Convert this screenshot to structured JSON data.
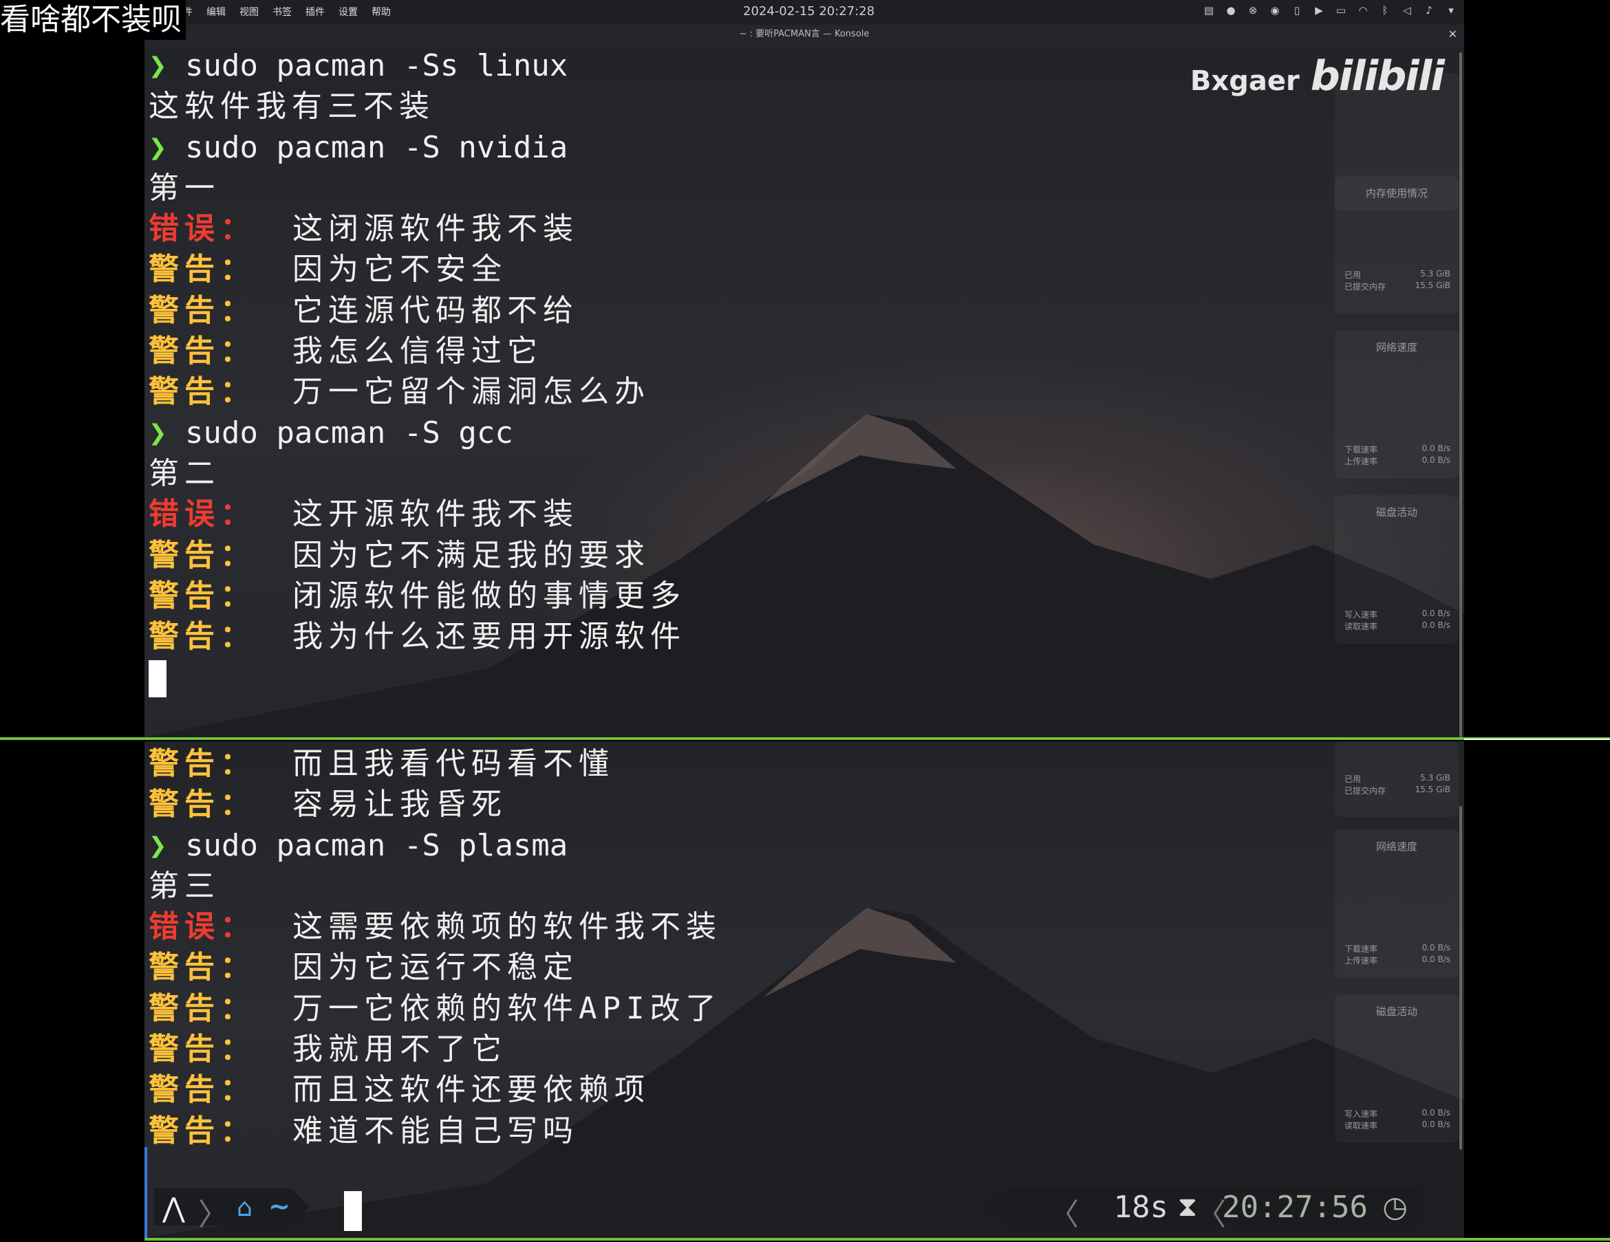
{
  "overlay_title": "看啥都不装呗",
  "menu": [
    "文件",
    "编辑",
    "视图",
    "书签",
    "插件",
    "设置",
    "帮助"
  ],
  "clock": "2024-02-15  20:27:28",
  "window_title": "~ : 要听PACMAN言 — Konsole",
  "watermark": {
    "author": "Bxgaer",
    "brand": "bilibili"
  },
  "widgets": {
    "memory_title": "内存使用情况",
    "memory_used": "已用",
    "memory_used_val": "5.3 GiB",
    "memory_committed": "已提交内存",
    "memory_committed_val": "15.5 GiB",
    "net_title": "网络速度",
    "net_down": "下载速率",
    "net_down_val": "0.0 B/s",
    "net_up": "上传速率",
    "net_up_val": "0.0 B/s",
    "disk_title": "磁盘活动",
    "disk_write": "写入速率",
    "disk_write_val": "0.0 B/s",
    "disk_read": "读取速率",
    "disk_read_val": "0.0 B/s"
  },
  "top_pane": [
    {
      "type": "cmd",
      "prompt": "❯",
      "text": " sudo pacman -Ss linux"
    },
    {
      "type": "plain",
      "text": "这软件我有三不装"
    },
    {
      "type": "cmd",
      "prompt": "❯",
      "text": " sudo pacman -S nvidia"
    },
    {
      "type": "plain",
      "text": "第一"
    },
    {
      "type": "err",
      "label": "错误：",
      "text": "这闭源软件我不装"
    },
    {
      "type": "warn",
      "label": "警告：",
      "text": "因为它不安全"
    },
    {
      "type": "warn",
      "label": "警告：",
      "text": "它连源代码都不给"
    },
    {
      "type": "warn",
      "label": "警告：",
      "text": "我怎么信得过它"
    },
    {
      "type": "warn",
      "label": "警告：",
      "text": "万一它留个漏洞怎么办"
    },
    {
      "type": "cmd",
      "prompt": "❯",
      "text": " sudo pacman -S gcc"
    },
    {
      "type": "plain",
      "text": "第二"
    },
    {
      "type": "err",
      "label": "错误：",
      "text": "这开源软件我不装"
    },
    {
      "type": "warn",
      "label": "警告：",
      "text": "因为它不满足我的要求"
    },
    {
      "type": "warn",
      "label": "警告：",
      "text": "闭源软件能做的事情更多"
    },
    {
      "type": "warn",
      "label": "警告：",
      "text": "我为什么还要用开源软件"
    }
  ],
  "bottom_pane": [
    {
      "type": "warn",
      "label": "警告：",
      "text": "而且我看代码看不懂"
    },
    {
      "type": "warn",
      "label": "警告：",
      "text": "容易让我昏死"
    },
    {
      "type": "cmd",
      "prompt": "❯",
      "text": " sudo pacman -S plasma"
    },
    {
      "type": "plain",
      "text": "第三"
    },
    {
      "type": "err",
      "label": "错误：",
      "text": "这需要依赖项的软件我不装"
    },
    {
      "type": "warn",
      "label": "警告：",
      "text": "因为它运行不稳定"
    },
    {
      "type": "warn",
      "label": "警告：",
      "text": "万一它依赖的软件API改了"
    },
    {
      "type": "warn",
      "label": "警告：",
      "text": "我就用不了它"
    },
    {
      "type": "warn",
      "label": "警告：",
      "text": "而且这软件还要依赖项"
    },
    {
      "type": "warn",
      "label": "警告：",
      "text": "难道不能自己写吗"
    }
  ],
  "statusbar": {
    "dir": "~",
    "duration": "18s",
    "time": "20:27:56"
  },
  "colors": {
    "prompt": "#7be84a",
    "error": "#ee3c32",
    "warning": "#ffc23a",
    "divider": "#6fc23a"
  }
}
